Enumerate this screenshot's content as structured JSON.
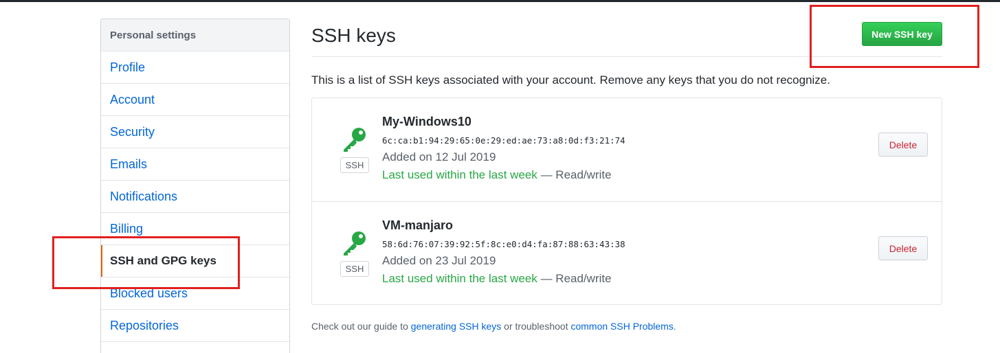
{
  "sidebar": {
    "header": "Personal settings",
    "items": [
      {
        "label": "Profile",
        "selected": false
      },
      {
        "label": "Account",
        "selected": false
      },
      {
        "label": "Security",
        "selected": false
      },
      {
        "label": "Emails",
        "selected": false
      },
      {
        "label": "Notifications",
        "selected": false
      },
      {
        "label": "Billing",
        "selected": false
      },
      {
        "label": "SSH and GPG keys",
        "selected": true
      },
      {
        "label": "Blocked users",
        "selected": false
      },
      {
        "label": "Repositories",
        "selected": false
      }
    ]
  },
  "main": {
    "title": "SSH keys",
    "new_key_label": "New SSH key",
    "intro": "This is a list of SSH keys associated with your account. Remove any keys that you do not recognize.",
    "keys": [
      {
        "title": "My-Windows10",
        "fingerprint": "6c:ca:b1:94:29:65:0e:29:ed:ae:73:a8:0d:f3:21:74",
        "added": "Added on 12 Jul 2019",
        "last_used": "Last used within the last week",
        "access": " — Read/write",
        "type_label": "SSH",
        "delete_label": "Delete"
      },
      {
        "title": "VM-manjaro",
        "fingerprint": "58:6d:76:07:39:92:5f:8c:e0:d4:fa:87:88:63:43:38",
        "added": "Added on 23 Jul 2019",
        "last_used": "Last used within the last week",
        "access": " — Read/write",
        "type_label": "SSH",
        "delete_label": "Delete"
      }
    ],
    "footer": {
      "prefix": "Check out our guide to ",
      "link1": "generating SSH keys",
      "middle": " or troubleshoot ",
      "link2": "common SSH Problems",
      "suffix": "."
    }
  },
  "colors": {
    "accent_green": "#28a745",
    "link_blue": "#0366d6",
    "delete_red": "#cb2431",
    "selected_marker": "#e36209",
    "annotation_red": "#e0201e"
  },
  "icons": {
    "key": "key-icon"
  }
}
